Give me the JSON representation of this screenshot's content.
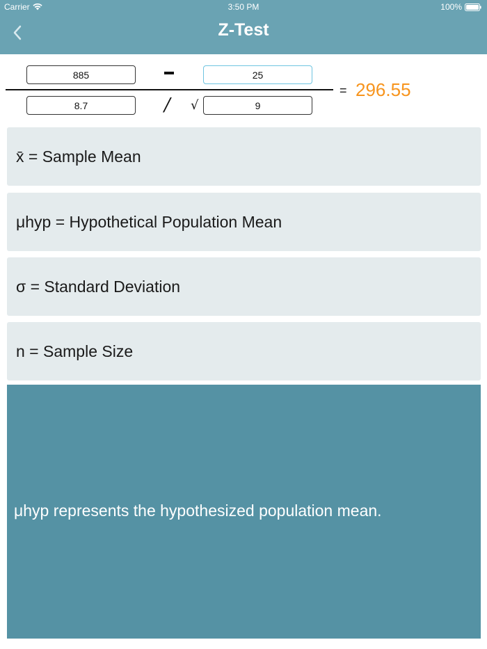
{
  "status_bar": {
    "carrier": "Carrier",
    "time": "3:50 PM",
    "battery": "100%"
  },
  "nav": {
    "title": "Z-Test",
    "back_icon": "chevron-left-icon",
    "color": "#6aa3b3"
  },
  "formula": {
    "sample_mean": "885",
    "hypothetical_mean": "25",
    "standard_deviation": "8.7",
    "sample_size": "9",
    "result": "296.55",
    "result_color": "#f7941d"
  },
  "definitions": [
    {
      "text": "x̄ = Sample Mean"
    },
    {
      "text": "μhyp = Hypothetical Population Mean"
    },
    {
      "text": "σ = Standard Deviation"
    },
    {
      "text": "n = Sample Size"
    }
  ],
  "explanation": {
    "text": "μhyp represents the hypothesized population mean.",
    "background": "#5592a4"
  }
}
